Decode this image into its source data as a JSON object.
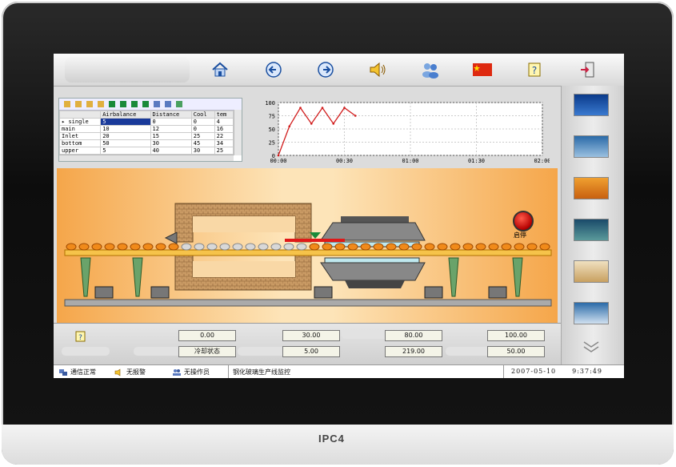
{
  "brand": "IPC4",
  "toolbar": {
    "buttons": [
      {
        "name": "home-icon"
      },
      {
        "name": "back-arrow-icon"
      },
      {
        "name": "forward-arrow-icon"
      },
      {
        "name": "alarm-bell-icon"
      },
      {
        "name": "users-icon"
      },
      {
        "name": "china-flag-icon"
      },
      {
        "name": "help-note-icon"
      },
      {
        "name": "exit-icon"
      }
    ]
  },
  "grid": {
    "headers": [
      "",
      "Airbalance",
      "Distance",
      "Cool",
      "tem"
    ],
    "rows": [
      [
        "single",
        "5",
        "0",
        "0",
        "4"
      ],
      [
        "main",
        "10",
        "12",
        "0",
        "16"
      ],
      [
        "Inlet",
        "20",
        "15",
        "25",
        "22"
      ],
      [
        "bottom",
        "50",
        "30",
        "45",
        "34"
      ],
      [
        "upper",
        "5",
        "40",
        "30",
        "25"
      ]
    ]
  },
  "chart_data": {
    "type": "line",
    "x": [
      "00:00",
      "00:05",
      "00:10",
      "00:15",
      "00:20",
      "00:25",
      "00:30",
      "00:35"
    ],
    "series": [
      {
        "values": [
          0,
          55,
          90,
          60,
          90,
          60,
          90,
          75
        ]
      }
    ],
    "xticks": [
      "00:00",
      "00:30",
      "01:00",
      "01:30",
      "02:00"
    ],
    "yticks": [
      "0",
      "25",
      "50",
      "75",
      "100"
    ],
    "ylim": [
      0,
      100
    ],
    "grid": true,
    "color": "#d11c1c"
  },
  "process": {
    "lamp_label": "启停"
  },
  "values": {
    "row1": [
      "0.00",
      "30.00",
      "80.00",
      "100.00"
    ],
    "row2": [
      "冷却状态",
      "5.00",
      "219.00",
      "50.00"
    ]
  },
  "status": {
    "comm": "通信正常",
    "alarm": "无报警",
    "operator": "无操作员",
    "title": "钢化玻璃生产线监控",
    "date": "2007-05-10",
    "time": "9:37:49"
  },
  "colors": {
    "accent": "#1a56c4",
    "furnace": "#c2915a",
    "roller": "#f08a1a"
  }
}
